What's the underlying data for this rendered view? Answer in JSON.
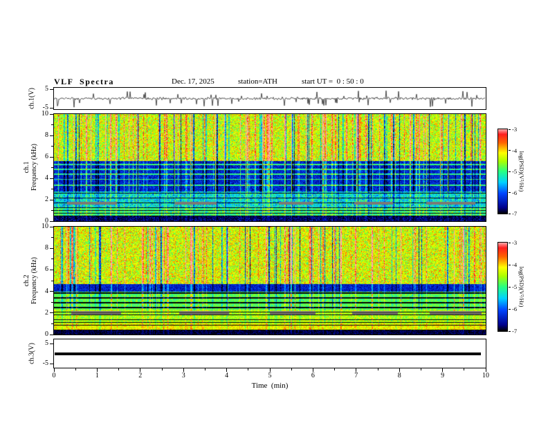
{
  "header": {
    "title": "VLF  Spectra",
    "date": "Dec. 17, 2025",
    "station": "station=ATH",
    "start_ut": "start UT =  0 : 50 : 0"
  },
  "axes": {
    "time_label": "Time  (min)",
    "time_ticks": [
      "0",
      "1",
      "2",
      "3",
      "4",
      "5",
      "6",
      "7",
      "8",
      "9",
      "10"
    ],
    "freq_ticks": [
      "10",
      "8",
      "6",
      "4",
      "2",
      "0"
    ],
    "volt_ticks": [
      "5",
      "-5"
    ]
  },
  "panels": {
    "wave1": {
      "label": "ch.1(V)"
    },
    "spec1": {
      "label_line1": "ch.1",
      "label_line2": "Frequency (kHz)"
    },
    "spec2": {
      "label_line1": "ch.2",
      "label_line2": "Frequency (kHz)"
    },
    "wave3": {
      "label": "ch.3(V)"
    }
  },
  "colorbar": {
    "label": "log(PSD)(V²/Hz)",
    "ticks": [
      "-3",
      "-4",
      "-5",
      "-6",
      "-7"
    ],
    "colormap_stops": [
      {
        "pos": 0.0,
        "color": "#000000"
      },
      {
        "pos": 0.07,
        "color": "#00008c"
      },
      {
        "pos": 0.24,
        "color": "#0046ff"
      },
      {
        "pos": 0.37,
        "color": "#00d2ff"
      },
      {
        "pos": 0.5,
        "color": "#28ff82"
      },
      {
        "pos": 0.62,
        "color": "#aaff00"
      },
      {
        "pos": 0.72,
        "color": "#ffff00"
      },
      {
        "pos": 0.84,
        "color": "#ff6400"
      },
      {
        "pos": 0.94,
        "color": "#ff1e1e"
      },
      {
        "pos": 1.0,
        "color": "#ffaaaa"
      }
    ]
  },
  "chart_data": [
    {
      "type": "line",
      "title": "ch.1(V) time series",
      "xlabel": "Time (min)",
      "ylabel": "ch.1(V)",
      "xlim": [
        0,
        10
      ],
      "ylim": [
        -5,
        5
      ],
      "series": [
        {
          "name": "ch.1 voltage",
          "description": "continuous broadband noise trace centred near 0 V with dense impulsive spikes (sferics) reaching roughly -4.5 to +3.5 V across the whole 0-10 min record"
        }
      ]
    },
    {
      "type": "heatmap",
      "title": "ch.1 spectrogram",
      "xlabel": "Time (min)",
      "ylabel": "Frequency (kHz)",
      "zlabel": "log(PSD)(V²/Hz)",
      "xlim": [
        0,
        10
      ],
      "ylim": [
        0,
        10
      ],
      "zlim": [
        -7,
        -3
      ],
      "colormap": "jet (red = -3, dark blue/black = -7)",
      "features": [
        "5.6-10 kHz: green-yellow background near -4.5 with many vertical impulsive streaks spanning all frequencies, some red (≈ -3) and some dark navy (≈ -7)",
        "2.8-5.6 kHz: broad low-power dark blue band near -6.5 crossed by thin cyan horizontal lines near 3.3, 3.9, 4.4, 4.9 and 5.3 kHz",
        "0.4-2.8 kHz: blue-green levels near -5.3 with regularly spaced thin black horizontal stripes",
        "grey intermittent horizontal segments near 1.6-1.8 kHz",
        "below 0.4 kHz: near-black band at the noise floor (≈ -7)"
      ]
    },
    {
      "type": "heatmap",
      "title": "ch.2 spectrogram",
      "xlabel": "Time (min)",
      "ylabel": "Frequency (kHz)",
      "zlabel": "log(PSD)(V²/Hz)",
      "xlim": [
        0,
        10
      ],
      "ylim": [
        0,
        10
      ],
      "zlim": [
        -7,
        -3
      ],
      "colormap": "jet (red = -3, dark blue/black = -7)",
      "features": [
        "4.7-10 kHz: green-yellow background near -4.4 with dense vertical impulsive streaks (red and dark navy)",
        "4.0-4.7 kHz: dark blue low-power band near -6.4",
        "2.3-4.0 kHz: green levels near -4.9 with thin black horizontal lines near 2.5, 3.0, 3.4 and 3.9 kHz",
        "0.4-2.3 kHz: green-yellow levels near -4.4 with closely spaced thin black horizontal stripes",
        "five intermittent grey horizontal segments near 2 kHz, roughly every 2 minutes",
        "below 0.35 kHz: near-black band at the noise floor (≈ -7)"
      ]
    },
    {
      "type": "line",
      "title": "ch.3(V) time series",
      "xlabel": "Time (min)",
      "ylabel": "ch.3(V)",
      "xlim": [
        0,
        10
      ],
      "ylim": [
        -5,
        5
      ],
      "series": [
        {
          "name": "ch.3 voltage",
          "description": "flat thick black trace constant at 0 V for the whole record"
        }
      ]
    }
  ]
}
